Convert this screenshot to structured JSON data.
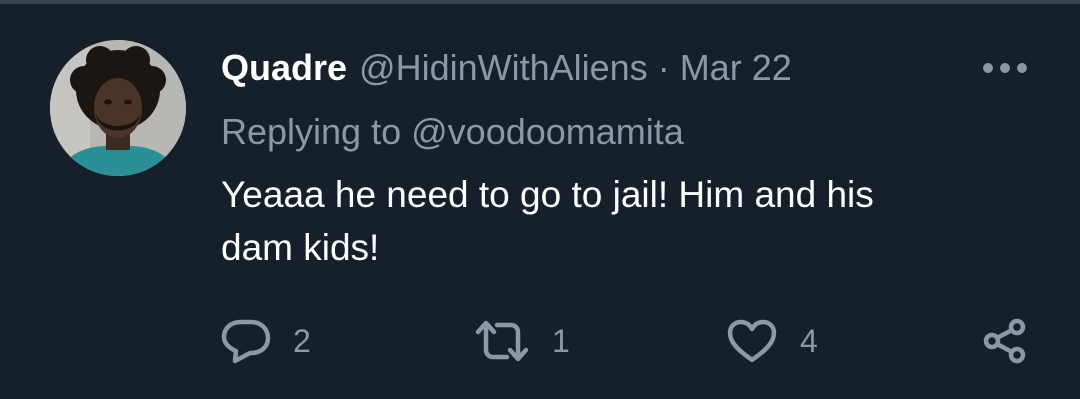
{
  "tweet": {
    "display_name": "Quadre",
    "handle": "@HidinWithAliens",
    "separator": "·",
    "date": "Mar 22",
    "replying_prefix": "Replying to",
    "replying_to": "@voodoomamita",
    "text_line1": "Yeaaa he need to go to jail! Him and his",
    "text_line2": "dam kids!"
  },
  "actions": {
    "reply_count": "2",
    "retweet_count": "1",
    "like_count": "4"
  },
  "icons": {
    "avatar": "user-avatar",
    "more": "more-icon",
    "reply": "reply-icon",
    "retweet": "retweet-icon",
    "like": "heart-icon",
    "share": "share-icon"
  },
  "colors": {
    "background": "#15202b",
    "primary_text": "#ffffff",
    "secondary_text": "#8b98a5",
    "divider": "#38444d"
  }
}
